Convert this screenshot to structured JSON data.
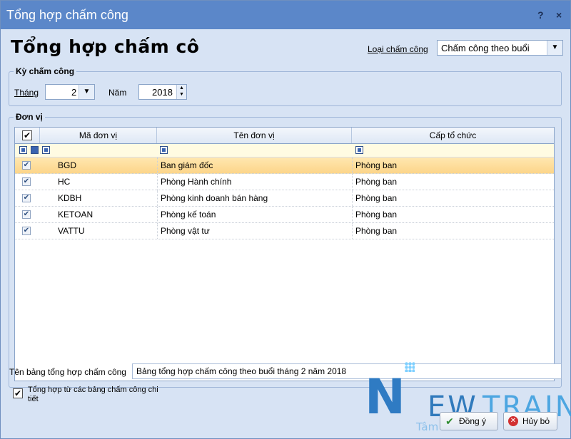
{
  "window": {
    "title": "Tổng hợp chấm công",
    "help_label": "?",
    "close_label": "×"
  },
  "header": {
    "heading": "Tổng hợp chấm cô"
  },
  "loai_cham_cong": {
    "label": "Loại chấm công",
    "value": "Chấm công theo buổi"
  },
  "ky_cham_cong": {
    "title": "Kỳ chấm công",
    "thang_label": "Tháng",
    "thang_value": "2",
    "nam_label": "Năm",
    "nam_value": "2018"
  },
  "don_vi": {
    "title": "Đơn vị",
    "columns": [
      "Mã đơn vị",
      "Tên đơn vị",
      "Cấp tổ chức"
    ],
    "rows": [
      {
        "ma": "BGD",
        "ten": "Ban giám đốc",
        "cap": "Phòng ban",
        "checked": true,
        "selected": true
      },
      {
        "ma": "HC",
        "ten": "Phòng Hành chính",
        "cap": "Phòng ban",
        "checked": true,
        "selected": false
      },
      {
        "ma": "KDBH",
        "ten": "Phòng kinh doanh bán hàng",
        "cap": "Phòng ban",
        "checked": true,
        "selected": false
      },
      {
        "ma": "KETOAN",
        "ten": "Phòng kế toán",
        "cap": "Phòng ban",
        "checked": true,
        "selected": false
      },
      {
        "ma": "VATTU",
        "ten": "Phòng vật tư",
        "cap": "Phòng ban",
        "checked": true,
        "selected": false
      }
    ]
  },
  "ten_bang": {
    "label": "Tên bảng tổng hợp chấm công",
    "value": "Bảng tổng hợp chấm công theo buổi tháng 2 năm 2018"
  },
  "option": {
    "label_line1": "Tổng hợp từ các bảng chấm công chi",
    "label_line2": "tiết",
    "checked": true
  },
  "buttons": {
    "ok": "Đồng ý",
    "cancel": "Hủy bỏ"
  },
  "watermark": {
    "big_letter": "N",
    "rest_a": "EW",
    "rest_b": "TRAIN",
    "sub": "Tâm   tâm   chất"
  }
}
